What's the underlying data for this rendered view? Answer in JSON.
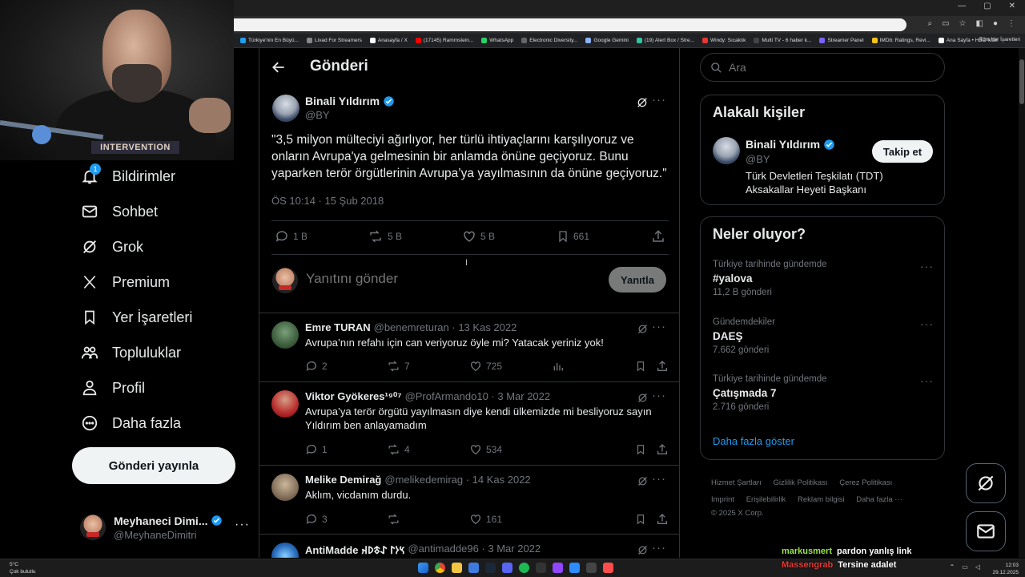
{
  "browser": {
    "bookmarks": [
      "Türkiye'nin En Büyü...",
      "Livad For Streamers",
      "Anasayfa / X",
      "(17145) Rammstein...",
      "WhatsApp",
      "Electronic Diversity...",
      "Google Gemini",
      "(19) Alert Box / Stre...",
      "Windy: Sıcaklık",
      "Multi TV - 6 haber k...",
      "Streamer Panel",
      "IMDb: Ratings, Revi...",
      "Ana Sayfa • HBO Max"
    ],
    "all_bookmarks": "Tüm Yer İşaretleri"
  },
  "webcam": {
    "shirt_text": "INTERVENTION"
  },
  "nav": {
    "items": [
      {
        "label": "Bildirimler",
        "icon": "bell-icon",
        "badge": "1"
      },
      {
        "label": "Sohbet",
        "icon": "mail-icon"
      },
      {
        "label": "Grok",
        "icon": "grok-icon"
      },
      {
        "label": "Premium",
        "icon": "x-logo-icon"
      },
      {
        "label": "Yer İşaretleri",
        "icon": "bookmark-icon"
      },
      {
        "label": "Topluluklar",
        "icon": "people-icon"
      },
      {
        "label": "Profil",
        "icon": "person-icon"
      },
      {
        "label": "Daha fazla",
        "icon": "more-circle-icon"
      }
    ],
    "post_button": "Gönderi yayınla",
    "account": {
      "name": "Meyhaneci Dimi...",
      "handle": "@MeyhaneDimitri"
    }
  },
  "main": {
    "title": "Gönderi",
    "tweet": {
      "name": "Binali Yıldırım",
      "handle": "@BY",
      "text": "\"3,5 milyon mülteciyi ağırlıyor, her türlü ihtiyaçlarını karşılıyoruz ve onların Avrupa'ya gelmesinin bir anlamda önüne geçiyoruz. Bunu yaparken terör örgütlerinin Avrupa’ya yayılmasının da önüne geçiyoruz.\"",
      "time": "ÖS 10:14 · 15 Şub 2018",
      "replies": "1 B",
      "reposts": "5 B",
      "likes": "5 B",
      "bookmarks": "661"
    },
    "compose": {
      "placeholder": "Yanıtını gönder",
      "button": "Yanıtla"
    },
    "replies": [
      {
        "name": "Emre TURAN",
        "meta": "@benemreturan · 13 Kas 2022",
        "text": "Avrupa’nın refahı için can veriyoruz öyle mi? Yatacak yeriniz yok!",
        "replies": "2",
        "reposts": "7",
        "likes": "725"
      },
      {
        "name": "Viktor Gyökeres¹⁹⁰⁷",
        "meta": "@ProfArmando10 · 3 Mar 2022",
        "text": "Avrupa’ya terör örgütü yayılmasın diye kendi ülkemizde mi besliyoruz sayın Yıldırım ben anlayamadım",
        "replies": "1",
        "reposts": "4",
        "likes": "534"
      },
      {
        "name": "Melike Demirağ",
        "meta": "@melikedemirag · 14 Kas 2022",
        "text": "Aklım, vicdanım durdu.",
        "replies": "3",
        "reposts": "",
        "likes": "161"
      },
      {
        "name": "AntiMadde 𐰽𐰆𐰃 𐰀𐱃𐰖𐰴",
        "meta": "@antimadde96 · 3 Mar 2022",
        "text": "",
        "replies": "",
        "reposts": "",
        "likes": ""
      }
    ]
  },
  "right": {
    "search_placeholder": "Ara",
    "related": {
      "title": "Alakalı kişiler",
      "name": "Binali Yıldırım",
      "handle": "@BY",
      "bio": "Türk Devletleri Teşkilatı (TDT) Aksakallar Heyeti Başkanı",
      "follow": "Takip et"
    },
    "trends": {
      "title": "Neler oluyor?",
      "items": [
        {
          "context": "Türkiye tarihinde gündemde",
          "name": "#yalova",
          "count": "11,2 B gönderi"
        },
        {
          "context": "Gündemdekiler",
          "name": "DAEŞ",
          "count": "7.662 gönderi"
        },
        {
          "context": "Türkiye tarihinde gündemde",
          "name": "Çatışmada 7",
          "count": "2.716 gönderi"
        }
      ],
      "show_more": "Daha fazla göster"
    },
    "footer": {
      "links": [
        "Hizmet Şartları",
        "Gizlilik Politikası",
        "Çerez Politikası",
        "Imprint",
        "Erişilebilirlik",
        "Reklam bilgisi",
        "Daha fazla ···"
      ],
      "copyright": "© 2025 X Corp."
    }
  },
  "chat": [
    {
      "user": "markusmert",
      "msg": "pardon yanlış link"
    },
    {
      "user": "Massengrab",
      "msg": "Tersine adalet"
    }
  ],
  "taskbar": {
    "weather_temp": "5°C",
    "weather_desc": "Çok bulutlu",
    "time": "12:03",
    "date": "29.12.2025"
  },
  "colors": {
    "accent": "#1d9bf0",
    "background": "#000000",
    "border": "#2f3336",
    "muted_text": "#71767b"
  }
}
